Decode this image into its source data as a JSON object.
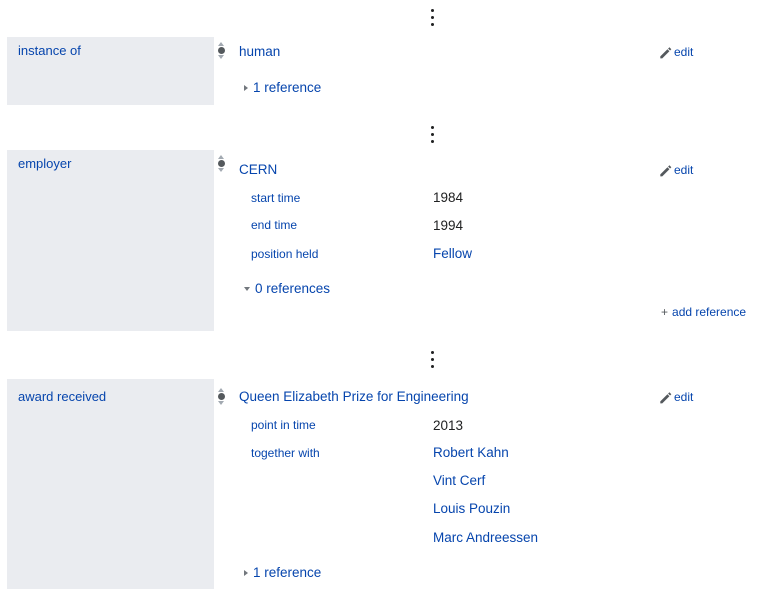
{
  "statements": [
    {
      "property": "instance of",
      "value": "human",
      "edit_label": "edit",
      "references_label": "1 reference",
      "references_expanded": false
    },
    {
      "property": "employer",
      "value": "CERN",
      "edit_label": "edit",
      "qualifiers": [
        {
          "property": "start time",
          "values": [
            "1984"
          ]
        },
        {
          "property": "end time",
          "values": [
            "1994"
          ]
        },
        {
          "property": "position held",
          "values": [
            "Fellow"
          ]
        }
      ],
      "references_label": "0 references",
      "references_expanded": true,
      "add_reference_label": "add reference"
    },
    {
      "property": "award received",
      "value": "Queen Elizabeth Prize for Engineering",
      "edit_label": "edit",
      "qualifiers": [
        {
          "property": "point in time",
          "values": [
            "2013"
          ]
        },
        {
          "property": "together with",
          "values": [
            "Robert Kahn",
            "Vint Cerf",
            "Louis Pouzin",
            "Marc Andreessen"
          ]
        }
      ],
      "references_label": "1 reference",
      "references_expanded": false
    }
  ],
  "icons": {
    "more": "vertical-ellipsis-icon",
    "rank": "normal-rank-icon",
    "edit": "pencil-icon",
    "collapsed": "triangle-right-icon",
    "expanded": "triangle-down-icon",
    "add": "plus-icon"
  },
  "colors": {
    "link": "#0645ad",
    "property_bg": "#eaecf0",
    "text": "#202122"
  }
}
